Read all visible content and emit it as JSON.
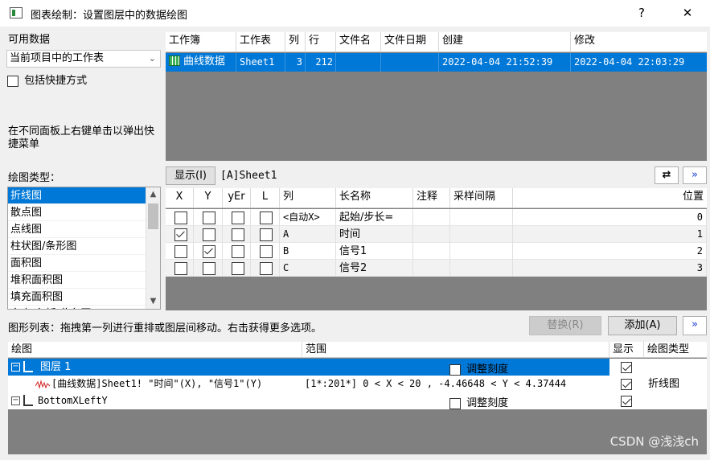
{
  "window": {
    "title": "图表绘制：设置图层中的数据绘图",
    "help_label": "?",
    "close_label": "✕"
  },
  "left": {
    "available_label": "可用数据",
    "source_select": "当前项目中的工作表",
    "include_shortcut_label": "包括快捷方式",
    "hint_text": "在不同面板上右键单击以弹出快捷菜单",
    "plot_type_label": "绘图类型：",
    "plot_types": [
      "折线图",
      "散点图",
      "点线图",
      "柱状图/条形图",
      "面积图",
      "堆积面积图",
      "填充面积图",
      "多点-条折-此条图"
    ]
  },
  "workbooks": {
    "columns": [
      "工作簿",
      "工作表",
      "列",
      "行",
      "文件名",
      "文件日期",
      "创建",
      "修改"
    ],
    "rows": [
      {
        "book": "曲线数据",
        "sheet": "Sheet1",
        "cols": "3",
        "rows": "212",
        "file": "",
        "file_date": "",
        "created": "2022-04-04 21:52:39",
        "modified": "2022-04-04 22:03:29"
      }
    ]
  },
  "columns_panel": {
    "show_button": "显示(I)",
    "sheet_path": "[A]Sheet1",
    "swap_icon": "⇄",
    "expand_icon": "»",
    "headers": [
      "X",
      "Y",
      "yEr",
      "L",
      "列",
      "长名称",
      "注释",
      "采样间隔",
      "位置"
    ],
    "rows": [
      {
        "x": false,
        "y": false,
        "yer": false,
        "l": false,
        "col": "<自动X>",
        "longname": "起始/步长=",
        "comment": "",
        "interval": "",
        "pos": "0"
      },
      {
        "x": true,
        "y": false,
        "yer": false,
        "l": false,
        "col": "A",
        "longname": "时间",
        "comment": "",
        "interval": "",
        "pos": "1"
      },
      {
        "x": false,
        "y": true,
        "yer": false,
        "l": false,
        "col": "B",
        "longname": "信号1",
        "comment": "",
        "interval": "",
        "pos": "2"
      },
      {
        "x": false,
        "y": false,
        "yer": false,
        "l": false,
        "col": "C",
        "longname": "信号2",
        "comment": "",
        "interval": "",
        "pos": "3"
      }
    ]
  },
  "plot_list": {
    "hint": "图形列表：拖拽第一列进行重排或图层间移动。右击获得更多选项。",
    "replace_button": "替换(R)",
    "add_button": "添加(A)",
    "expand_icon": "»",
    "headers": [
      "绘图",
      "范围",
      "显示",
      "绘图类型"
    ],
    "layer_label": "图层 1",
    "rescale_label": "调整刻度",
    "plot_item": "[曲线数据]Sheet1! \"时间\"(X), \"信号1\"(Y)",
    "plot_range": "[1*:201*]   0 < X < 20 , -4.46648 < Y < 4.37444",
    "plot_type": "折线图",
    "axis_label": "BottomXLeftY",
    "rescale_label2": "调整刻度"
  },
  "watermark": "CSDN @浅浅ch"
}
